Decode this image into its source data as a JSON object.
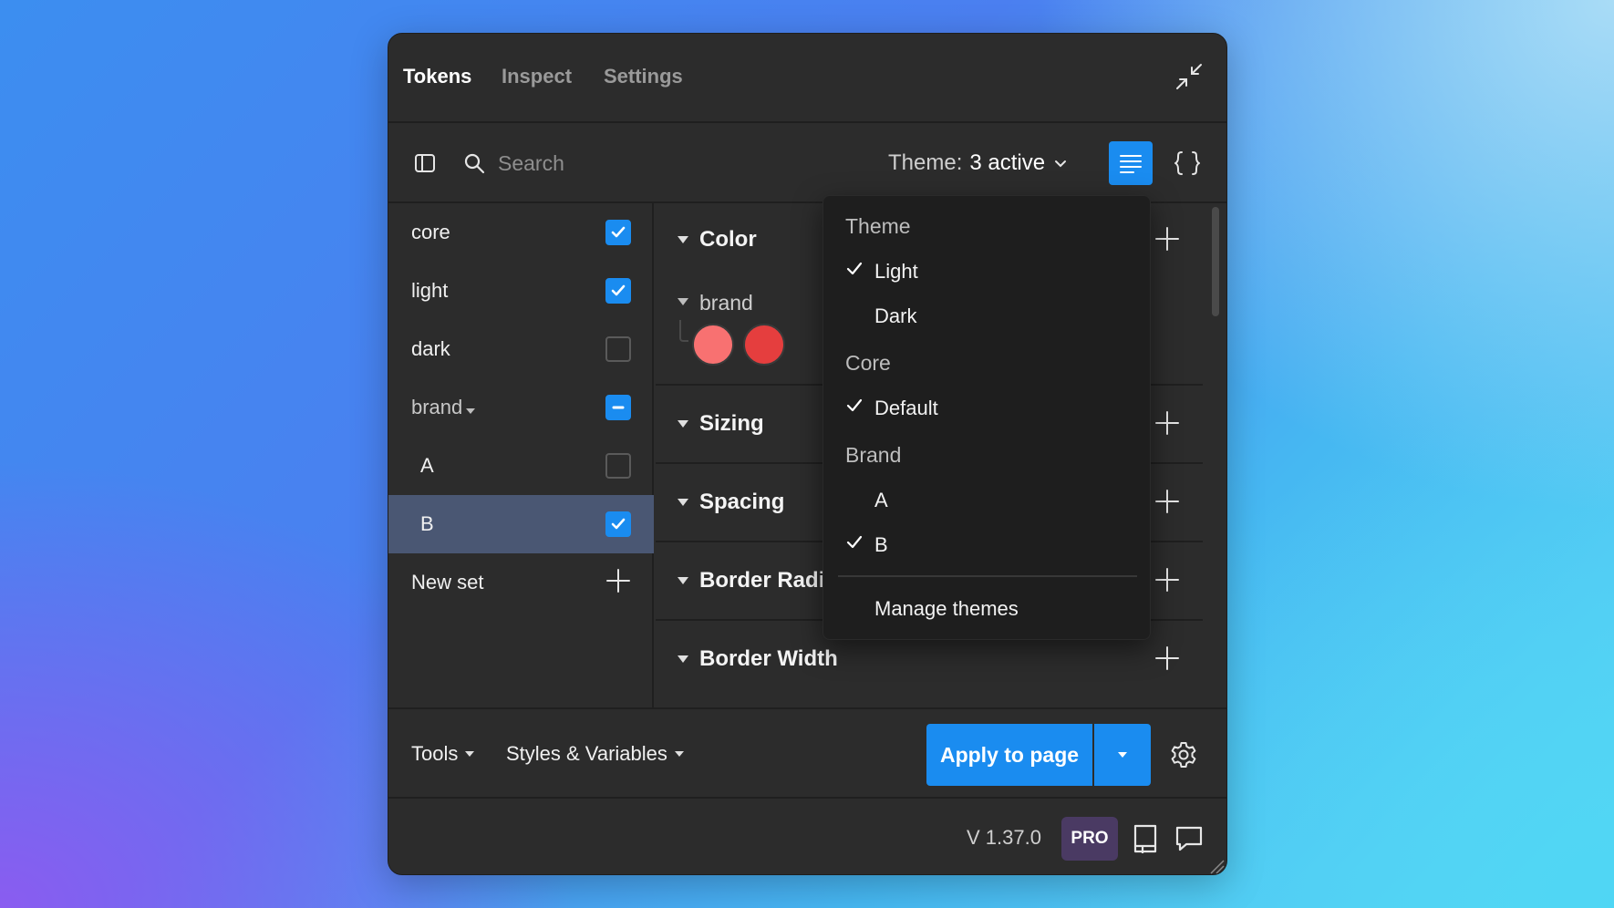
{
  "tabs": [
    {
      "label": "Tokens",
      "active": true
    },
    {
      "label": "Inspect",
      "active": false
    },
    {
      "label": "Settings",
      "active": false
    }
  ],
  "toolbar": {
    "search_placeholder": "Search",
    "theme_label": "Theme:",
    "theme_value": "3 active"
  },
  "sets": [
    {
      "label": "core",
      "state": "checked"
    },
    {
      "label": "light",
      "state": "checked"
    },
    {
      "label": "dark",
      "state": "unchecked"
    },
    {
      "label": "brand",
      "state": "indeterminate",
      "folder": true
    },
    {
      "label": "A",
      "state": "unchecked"
    },
    {
      "label": "B",
      "state": "checked",
      "selected": true
    }
  ],
  "new_set_label": "New set",
  "groups": [
    {
      "title": "Color",
      "subgroup": "brand",
      "swatches": [
        "#f87171",
        "#e53e3e"
      ]
    },
    {
      "title": "Sizing"
    },
    {
      "title": "Spacing"
    },
    {
      "title": "Border Radiu"
    },
    {
      "title": "Border Width"
    }
  ],
  "theme_menu": {
    "sections": [
      {
        "header": "Theme",
        "items": [
          {
            "label": "Light",
            "checked": true
          },
          {
            "label": "Dark",
            "checked": false
          }
        ]
      },
      {
        "header": "Core",
        "items": [
          {
            "label": "Default",
            "checked": true
          }
        ]
      },
      {
        "header": "Brand",
        "items": [
          {
            "label": "A",
            "checked": false
          },
          {
            "label": "B",
            "checked": true
          }
        ]
      }
    ],
    "manage_label": "Manage themes"
  },
  "bottombar": {
    "tools_label": "Tools",
    "styles_label": "Styles & Variables",
    "apply_label": "Apply to page"
  },
  "footer": {
    "version": "V 1.37.0",
    "badge": "PRO"
  },
  "colors": {
    "accent": "#1a8cf0",
    "panel": "#2c2c2c",
    "selected_row": "#4a5773",
    "pro_badge": "#4a3a63"
  }
}
